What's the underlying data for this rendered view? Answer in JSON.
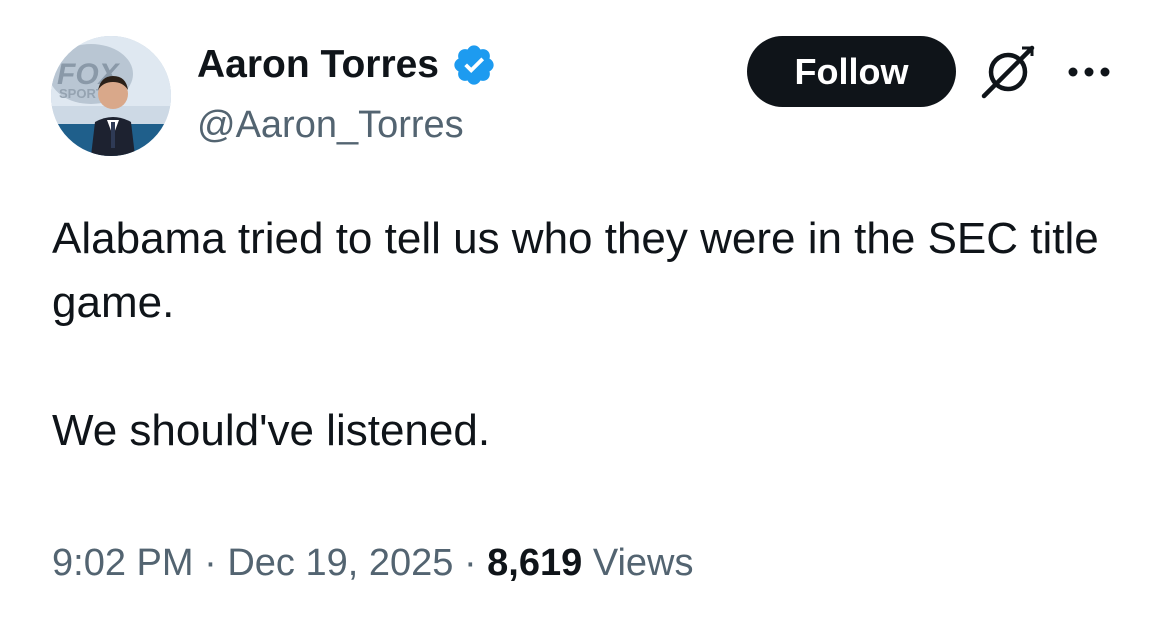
{
  "author": {
    "display_name": "Aaron Torres",
    "handle": "@Aaron_Torres",
    "verified": true,
    "avatar_icon": "profile-photo",
    "verified_icon": "verified-badge-icon",
    "verified_color": "#1d9bf0"
  },
  "actions": {
    "follow_label": "Follow",
    "grok_icon": "grok-icon",
    "more_icon": "more-options-icon"
  },
  "tweet": {
    "paragraphs": [
      "Alabama tried to tell us who they were in the SEC title game.",
      "We should've listened."
    ]
  },
  "meta": {
    "time": "9:02 PM",
    "separator": "·",
    "date": "Dec 19, 2025",
    "views_count": "8,619",
    "views_label": "Views"
  },
  "colors": {
    "text": "#0f1419",
    "secondary": "#536471",
    "button_bg": "#0f1419",
    "button_text": "#ffffff"
  }
}
